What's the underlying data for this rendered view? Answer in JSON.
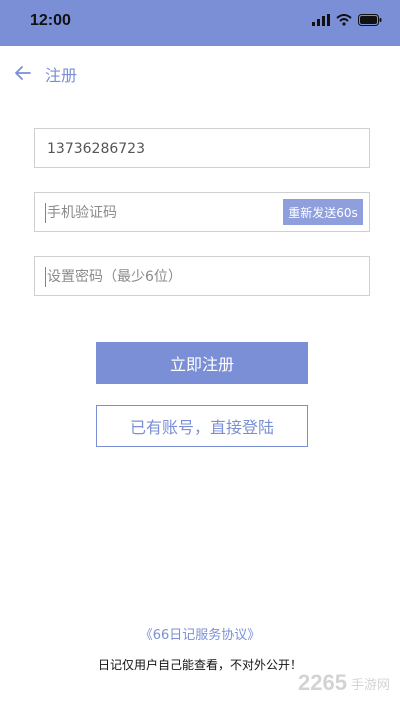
{
  "status_bar": {
    "time": "12:00",
    "icons": [
      "signal-icon",
      "wifi-icon",
      "battery-icon"
    ],
    "bg_color": "#7b8fd6"
  },
  "nav": {
    "title": "注册",
    "back_icon": "arrow-left-icon"
  },
  "form": {
    "phone_value": "13736286723",
    "code_placeholder": "手机验证码",
    "resend_label": "重新发送60s",
    "password_placeholder": "设置密码（最少6位）"
  },
  "buttons": {
    "register_label": "立即注册",
    "login_label": "已有账号，直接登陆"
  },
  "footer": {
    "agreement": "《66日记服务协议》",
    "privacy_note": "日记仅用户自己能查看，不对外公开！"
  },
  "watermark": {
    "number": "2265",
    "text": "手游网"
  },
  "colors": {
    "accent": "#7b8fd6"
  }
}
